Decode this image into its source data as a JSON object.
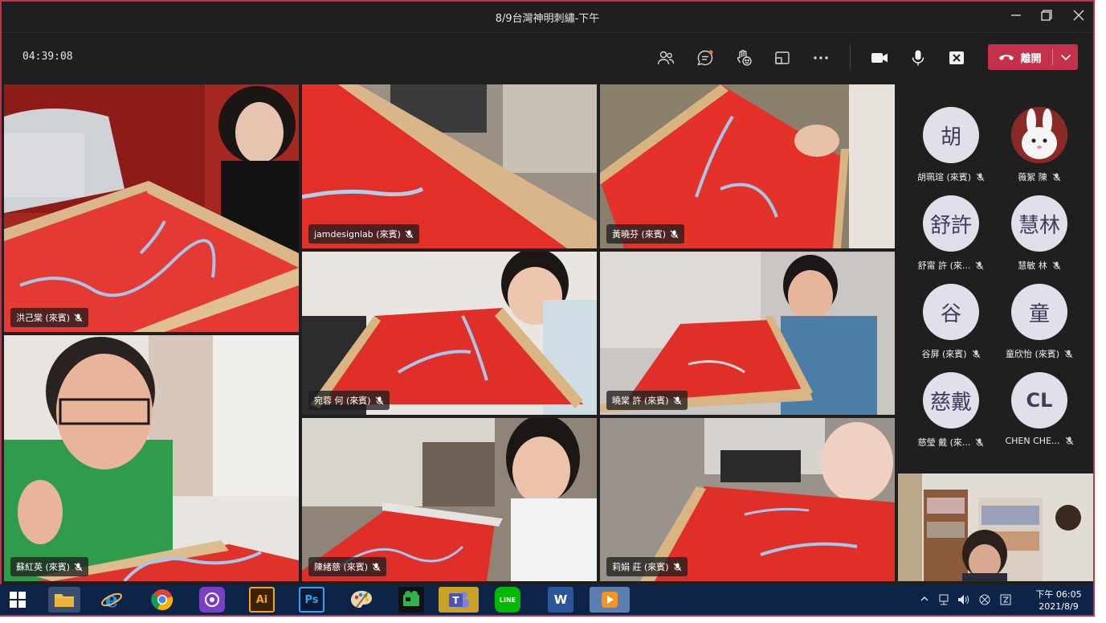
{
  "window": {
    "title": "8/9台灣神明刺繡-下午"
  },
  "toolbar": {
    "timer": "04:39:08",
    "leave_label": "離開"
  },
  "tiles": [
    {
      "name": "洪己棠 (來賓)"
    },
    {
      "name": "jamdesignlab (來賓)"
    },
    {
      "name": "黃曉芬 (來賓)"
    },
    {
      "name": "蘇紅英 (來賓)"
    },
    {
      "name": "宛蓉 何 (來賓)"
    },
    {
      "name": "曉棠 許 (來賓)"
    },
    {
      "name": "陳緒慈 (來賓)"
    },
    {
      "name": "莉娟 莊 (來賓)"
    }
  ],
  "roster": [
    {
      "initials": "胡",
      "name": "胡珮瑄 (來賓)"
    },
    {
      "initials": "",
      "name": "薇絮 陳"
    },
    {
      "initials": "舒許",
      "name": "舒甯 許 (來..."
    },
    {
      "initials": "慧林",
      "name": "慧敏 林"
    },
    {
      "initials": "谷",
      "name": "谷屏 (來賓)"
    },
    {
      "initials": "童",
      "name": "童欣怡 (來賓)"
    },
    {
      "initials": "慈戴",
      "name": "慈瑩 戴 (來..."
    },
    {
      "initials": "CL",
      "name": "CHEN CHE..."
    }
  ],
  "taskbar": {
    "apps": [
      "start-button",
      "file-explorer",
      "internet-explorer",
      "chrome",
      "camera-app",
      "illustrator",
      "photoshop",
      "paint",
      "video-editor",
      "teams",
      "line",
      "word",
      "media-player"
    ],
    "illustrator_label": "Ai",
    "photoshop_label": "Ps",
    "line_label": "LINE",
    "word_label": "W",
    "teams_label": "T"
  },
  "clock": {
    "time": "下午 06:05",
    "date": "2021/8/9"
  },
  "colors": {
    "leave": "#c4314b",
    "background": "#201f1f",
    "avatar": "#e1dfea",
    "taskbar": "#0d2347",
    "fabric": "#d8201f"
  }
}
